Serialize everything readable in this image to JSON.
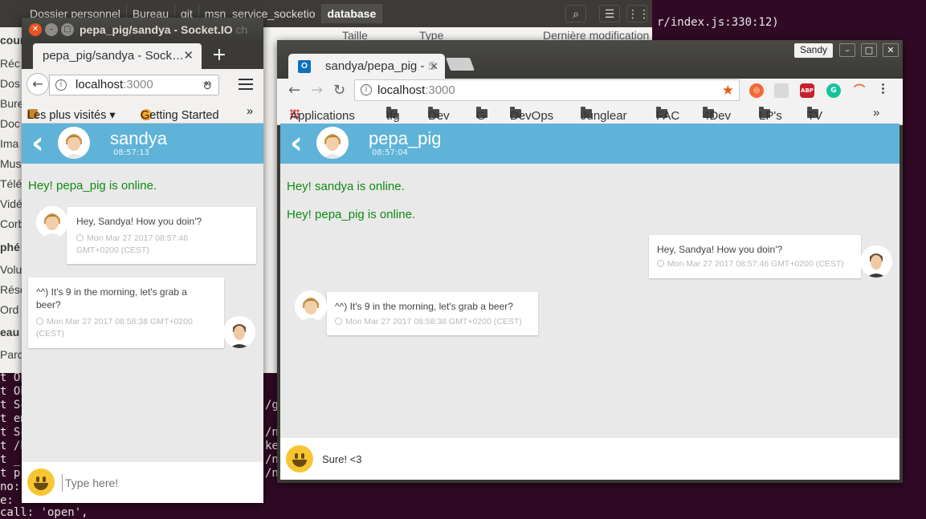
{
  "terminal": {
    "lines": [
      "t Ob",
      "t Ob",
      "t Sc",
      "t em",
      "t Sc",
      "t /h",
      "t _",
      "t pr",
      "no: ",
      "e: ",
      "call: 'open',"
    ],
    "right_text": "r/index.js:330:12)",
    "side_fragments": [
      "/g",
      "/n",
      "/n",
      "ke",
      "/n",
      "/n"
    ]
  },
  "file_manager": {
    "breadcrumbs": [
      "Dossier personnel",
      "Bureau",
      "git",
      "msn_service_socketio",
      "database"
    ],
    "sidebar": [
      "cour",
      "Réc",
      "Dos",
      "Bure",
      "Doc",
      "Ima",
      "Mus",
      "Télé",
      "Vidé",
      "Corb",
      "phé",
      "Volu",
      "Rése",
      "Ord",
      "eau",
      "Parc"
    ],
    "column_headers": [
      "Taille",
      "Type",
      "Dernière modification"
    ]
  },
  "firefox": {
    "window_title": "pepa_pig/sandya - Socket.IO",
    "window_title_faded": " ch",
    "tab_label": "pepa_pig/sandya - Sock…",
    "tab_close": "✕",
    "new_tab": "+",
    "url_host": "localhost",
    "url_port": ":3000",
    "bookmarks": [
      "Les plus visités ▾",
      "Getting Started"
    ],
    "overflow": "»"
  },
  "chat_left": {
    "back": "‹",
    "name": "sandya",
    "time": "08:57:13",
    "status_msgs": [
      "Hey! pepa_pig is online."
    ],
    "messages": [
      {
        "text": "Hey, Sandya! How you doin'?",
        "date": "Mon Mar 27 2017 08:57:46 GMT+0200 (CEST)"
      },
      {
        "text": "^^) It's 9 in the morning, let's grab a beer?",
        "date": "Mon Mar 27 2017 08:58:38 GMT+0200 (CEST)"
      }
    ],
    "input_placeholder": "Type here!"
  },
  "chrome": {
    "user": "Sandy",
    "tab_label": "sandya/pepa_pig - ",
    "tab_label_faded": "S",
    "tab_close": "✕",
    "url_host": "localhost",
    "url_port": ":3000",
    "bookmarks": [
      "Applications",
      "tfg",
      "Dev",
      "G",
      "DevOps",
      "Junglear",
      "FAC",
      "4Dev",
      "LP's",
      "TV"
    ],
    "overflow": "»",
    "ext_abp": "ABP",
    "ext_g": "G"
  },
  "chat_right": {
    "back": "‹",
    "name": "pepa_pig",
    "time": "08:57:04",
    "status_msgs": [
      "Hey! sandya is online.",
      "Hey! pepa_pig is online."
    ],
    "messages": [
      {
        "text": "Hey, Sandya! How you doin'?",
        "date": "Mon Mar 27 2017 08:57:46 GMT+0200 (CEST)"
      },
      {
        "text": "^^) It's 9 in the morning, let's grab a beer?",
        "date": "Mon Mar 27 2017 08:58:38 GMT+0200 (CEST)"
      }
    ],
    "input_value": "Sure! <3"
  },
  "colors": {
    "header": "#5fb3d9",
    "online": "#0f8a12",
    "terminal": "#300a24"
  }
}
